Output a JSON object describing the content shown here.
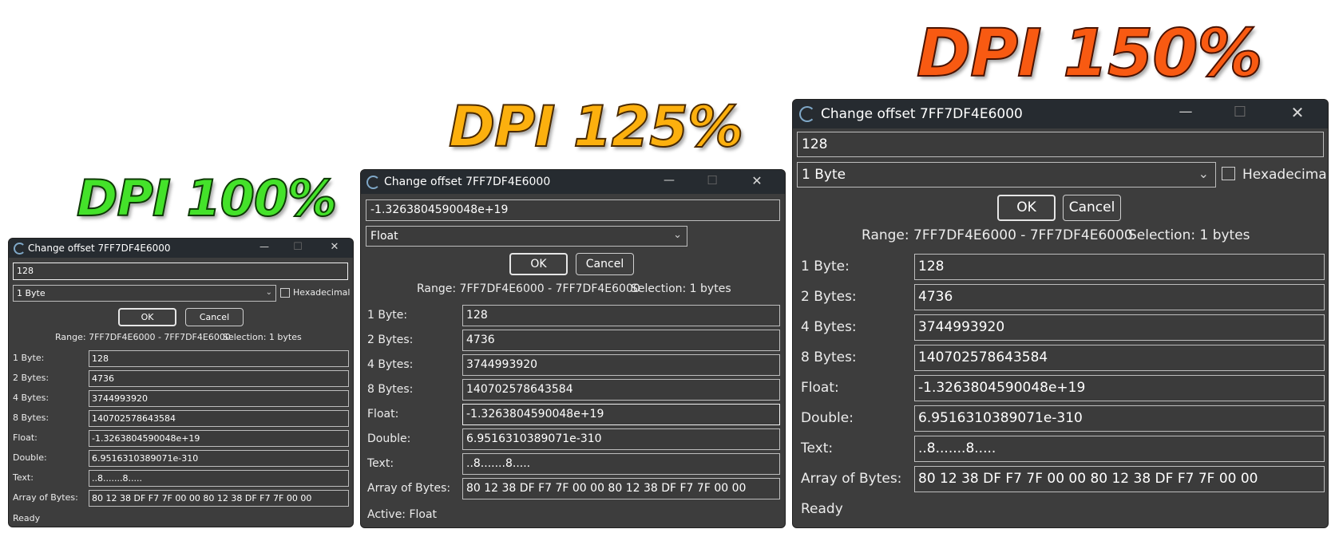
{
  "banners": {
    "dpi100": "DPI 100%",
    "dpi125": "DPI 125%",
    "dpi150": "DPI 150%"
  },
  "dialog": {
    "title": "Change offset 7FF7DF4E6000",
    "controls": {
      "minimize": "—",
      "maximize": "☐",
      "close": "✕"
    },
    "ok_label": "OK",
    "cancel_label": "Cancel",
    "hex_label": "Hexadecimal",
    "range_text": "Range: 7FF7DF4E6000 - 7FF7DF4E6000",
    "selection_text": "Selection: 1 bytes",
    "rows": [
      {
        "label": "1 Byte:",
        "value": "128"
      },
      {
        "label": "2 Bytes:",
        "value": "4736"
      },
      {
        "label": "4 Bytes:",
        "value": "3744993920"
      },
      {
        "label": "8 Bytes:",
        "value": "140702578643584"
      },
      {
        "label": "Float:",
        "value": "-1.3263804590048e+19"
      },
      {
        "label": "Double:",
        "value": "6.9516310389071e-310"
      },
      {
        "label": "Text:",
        "value": "..8.......8....."
      },
      {
        "label": "Array of Bytes:",
        "value": "80 12 38 DF F7 7F 00 00 80 12 38 DF F7 7F 00 00"
      }
    ]
  },
  "win100": {
    "input_value": "128",
    "type_selected": "1 Byte",
    "status": "Ready"
  },
  "win125": {
    "input_value": "-1.3263804590048e+19",
    "type_selected": "Float",
    "status": "Active: Float"
  },
  "win150": {
    "input_value": "128",
    "type_selected": "1 Byte",
    "status": "Ready"
  }
}
